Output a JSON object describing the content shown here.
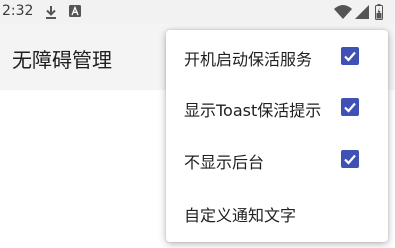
{
  "status_bar": {
    "time": "2:32",
    "icons": [
      "download-icon",
      "a-notification-icon",
      "wifi-icon",
      "signal-icon",
      "battery-icon"
    ]
  },
  "app_bar": {
    "title": "无障碍管理"
  },
  "menu": {
    "items": [
      {
        "label": "开机启动保活服务",
        "checked": true
      },
      {
        "label": "显示Toast保活提示",
        "checked": true
      },
      {
        "label": "不显示后台",
        "checked": true
      },
      {
        "label": "自定义通知文字",
        "checked": null
      }
    ]
  },
  "colors": {
    "checkbox": "#3f51b5",
    "app_bar": "#f4f4f4",
    "status_bar": "#f2f2f2"
  }
}
